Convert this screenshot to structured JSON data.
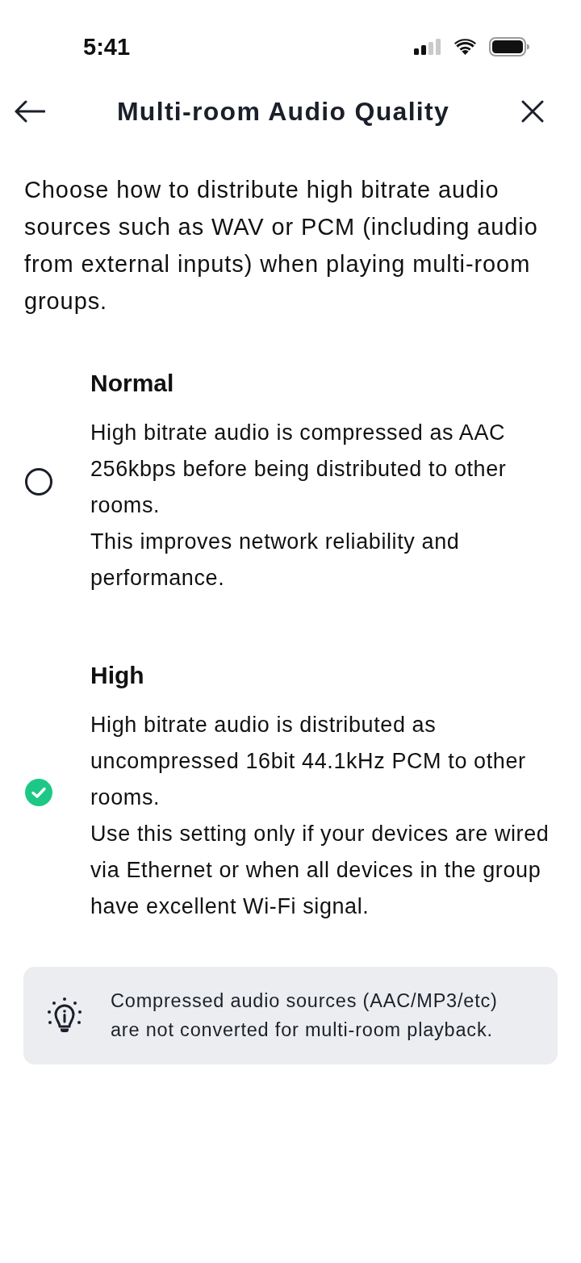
{
  "status_bar": {
    "time": "5:41"
  },
  "header": {
    "title": "Multi-room Audio Quality"
  },
  "intro": "Choose how to distribute high bitrate audio sources such as WAV or PCM (including audio from external inputs) when playing multi-room groups.",
  "options": [
    {
      "title": "Normal",
      "selected": false,
      "description": [
        "High bitrate audio is compressed as AAC 256kbps before being distributed to other rooms.",
        "This improves network reliability and performance."
      ]
    },
    {
      "title": "High",
      "selected": true,
      "description": [
        "High bitrate audio is distributed as uncompressed 16bit 44.1kHz PCM to other rooms.",
        "Use this setting only if your devices are wired via Ethernet or when all devices in the group have excellent Wi-Fi signal."
      ]
    }
  ],
  "hint": {
    "text": "Compressed audio sources (AAC/MP3/etc) are not converted for multi-room playback."
  }
}
